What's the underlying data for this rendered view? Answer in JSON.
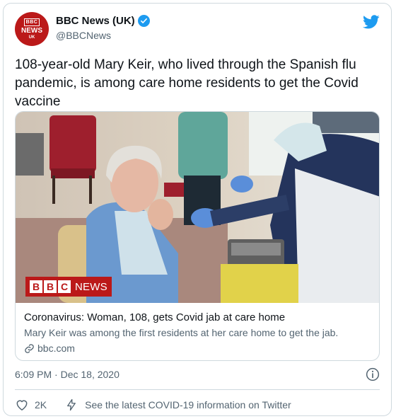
{
  "account": {
    "display_name": "BBC News (UK)",
    "handle": "@BBCNews",
    "avatar_lines": [
      "BBC",
      "NEWS",
      "UK"
    ],
    "verified": true
  },
  "tweet": {
    "text": "108-year-old Mary Keir, who lived through the Spanish flu pandemic, is among care home residents to get the Covid vaccine",
    "timestamp": "6:09 PM · Dec 18, 2020"
  },
  "link_card": {
    "image_logo_letters": [
      "B",
      "B",
      "C"
    ],
    "image_logo_word": "NEWS",
    "title": "Coronavirus: Woman, 108, gets Covid jab at care home",
    "description": "Mary Keir was among the first residents at her care home to get the jab.",
    "domain": "bbc.com"
  },
  "actions": {
    "like_count": "2K",
    "covid_info": "See the latest COVID-19 information on Twitter"
  },
  "colors": {
    "bbc_red": "#bb1919",
    "twitter_blue": "#1d9bf0",
    "secondary_text": "#536471",
    "border": "#cfd9de"
  },
  "icons": [
    "twitter-bird-icon",
    "verified-badge-icon",
    "link-icon",
    "info-icon",
    "heart-icon",
    "lightning-icon"
  ]
}
